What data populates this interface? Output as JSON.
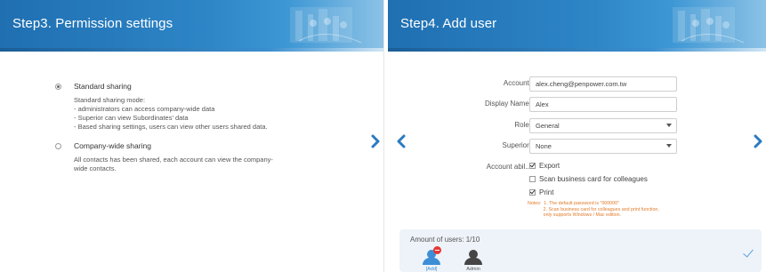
{
  "step3": {
    "title": "Step3. Permission settings",
    "options": [
      {
        "label": "Standard sharing",
        "checked": true,
        "description": [
          "Standard sharing mode:",
          "- administrators can access company-wide data",
          "- Superior can view Subordinates’ data",
          "- Based sharing settings, users can view other users shared data."
        ]
      },
      {
        "label": "Company-wide sharing",
        "checked": false,
        "description": [
          "All contacts has been shared, each account can view the company-",
          "wide contacts."
        ]
      }
    ]
  },
  "step4": {
    "title": "Step4. Add user",
    "fields": {
      "account": {
        "label": "Account:",
        "value": "alex.cheng@penpower.com.tw"
      },
      "display_name": {
        "label": "Display Name:",
        "value": "Alex"
      },
      "role": {
        "label": "Role:",
        "value": "General"
      },
      "superior": {
        "label": "Superior:",
        "value": "None"
      }
    },
    "ability": {
      "label": "Account abil...",
      "options": [
        {
          "label": "Export",
          "checked": true
        },
        {
          "label": "Scan business card for colleagues",
          "checked": false
        },
        {
          "label": "Print",
          "checked": true
        }
      ]
    },
    "notes": [
      "Notes:  1. The default password is \"000000\"",
      "            2. Scan business card for colleagues and print function,",
      "            only supports Windows / Mac edition."
    ],
    "users": {
      "title": "Amount of users: 1/10",
      "items": [
        {
          "label": "[Add]",
          "color": "#3d8ed6",
          "badge": true
        },
        {
          "label": "Admin",
          "color": "#454545",
          "badge": false
        }
      ]
    }
  },
  "icons": {
    "next": "chevron-right-icon",
    "prev": "chevron-left-icon",
    "user": "user-icon",
    "remove": "remove-badge-icon",
    "confirm": "checkmark-icon"
  },
  "colors": {
    "header_blue": "#2e86c7",
    "arrow_blue": "#2a7bc0",
    "notes_orange": "#e07b2a",
    "users_panel_bg": "#eef3f9"
  }
}
